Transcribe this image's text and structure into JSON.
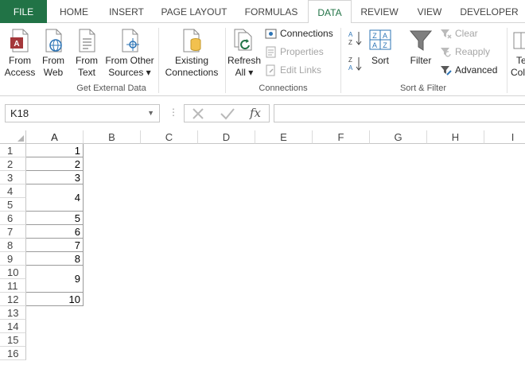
{
  "tabs": [
    "FILE",
    "HOME",
    "INSERT",
    "PAGE LAYOUT",
    "FORMULAS",
    "DATA",
    "REVIEW",
    "VIEW",
    "DEVELOPER"
  ],
  "ribbon": {
    "get_external": {
      "from_access": [
        "From",
        "Access"
      ],
      "from_web": [
        "From",
        "Web"
      ],
      "from_text": [
        "From",
        "Text"
      ],
      "from_other": [
        "From Other",
        "Sources ▾"
      ],
      "label": "Get External Data"
    },
    "existing": [
      "Existing",
      "Connections"
    ],
    "connections": {
      "refresh": [
        "Refresh",
        "All ▾"
      ],
      "connections": "Connections",
      "properties": "Properties",
      "edit_links": "Edit Links",
      "label": "Connections"
    },
    "sort_filter": {
      "sort": "Sort",
      "filter": "Filter",
      "clear": "Clear",
      "reapply": "Reapply",
      "advanced": "Advanced",
      "label": "Sort & Filter"
    },
    "partial": [
      "Te",
      "Col"
    ]
  },
  "formula_bar": {
    "name_box": "K18",
    "fx_symbol": "fx",
    "formula": ""
  },
  "grid": {
    "columns": [
      "A",
      "B",
      "C",
      "D",
      "E",
      "F",
      "G",
      "H",
      "I"
    ],
    "rows": [
      "1",
      "2",
      "3",
      "4",
      "5",
      "6",
      "7",
      "8",
      "9",
      "10",
      "11",
      "12",
      "13",
      "14",
      "15",
      "16"
    ],
    "a_values": [
      "1",
      "2",
      "3",
      "4",
      "5",
      "6",
      "7",
      "8",
      "9",
      "10"
    ]
  },
  "colors": {
    "file_tab": "#217346",
    "active_tab_text": "#217346"
  }
}
